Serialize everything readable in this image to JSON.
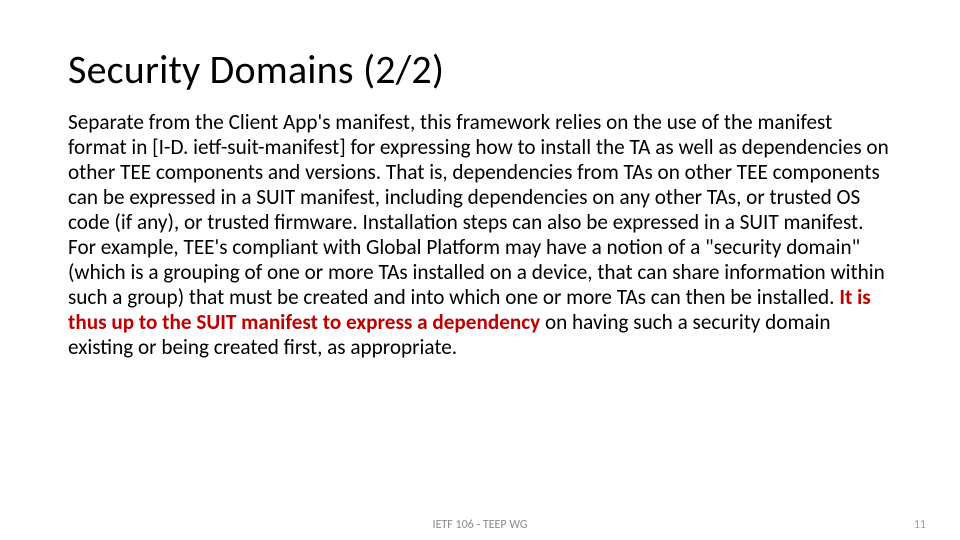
{
  "title": "Security Domains (2/2)",
  "body": {
    "para1": "Separate from the Client App's manifest, this framework relies on the use of the manifest format in [I-D. ietf-suit-manifest] for expressing how to install the TA as well as dependencies on other TEE components and versions.  That is, dependencies from TAs on other TEE components can be expressed in a SUIT manifest, including dependencies on any other TAs, or trusted OS code (if any), or trusted firmware. Installation steps can also be expressed in a SUIT manifest.",
    "para2_a": "For example, TEE's compliant with Global Platform may have a notion of a \"security domain\" (which is a grouping of one or more TAs installed on a device, that can share information within such a group) that must be created and into which one or more TAs can then be installed.  ",
    "para2_emph": "It is thus up to the SUIT manifest to express a dependency",
    "para2_b": " on having such a security domain existing or being created first, as appropriate."
  },
  "footer": {
    "center": "IETF 106 - TEEP WG",
    "page": "11"
  }
}
